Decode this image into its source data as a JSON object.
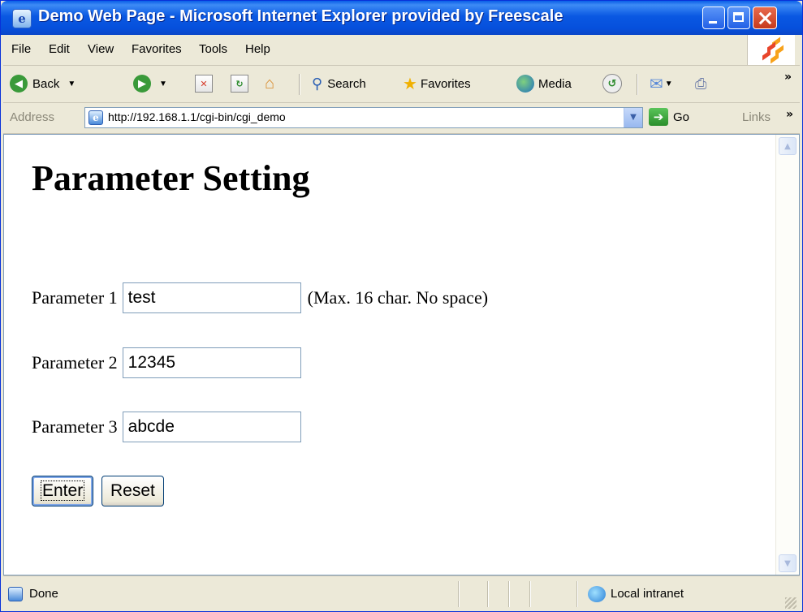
{
  "window": {
    "title": "Demo Web Page - Microsoft Internet Explorer provided by Freescale"
  },
  "menu": {
    "items": [
      "File",
      "Edit",
      "View",
      "Favorites",
      "Tools",
      "Help"
    ]
  },
  "toolbar": {
    "back": "Back",
    "search": "Search",
    "favorites": "Favorites",
    "media": "Media"
  },
  "address": {
    "label": "Address",
    "url": "http://192.168.1.1/cgi-bin/cgi_demo",
    "go": "Go",
    "links": "Links"
  },
  "page": {
    "title": "Parameter Setting",
    "params": [
      {
        "label": "Parameter 1",
        "value": "test",
        "hint": "(Max. 16 char. No space)"
      },
      {
        "label": "Parameter 2",
        "value": "12345"
      },
      {
        "label": "Parameter 3",
        "value": "abcde"
      }
    ],
    "enter_label": "Enter",
    "reset_label": "Reset"
  },
  "status": {
    "text": "Done",
    "zone": "Local intranet"
  },
  "colors": {
    "title_bar": "#0a58e2",
    "close_button": "#c6391d",
    "chrome": "#ece9d8",
    "input_border": "#7f9db9"
  }
}
